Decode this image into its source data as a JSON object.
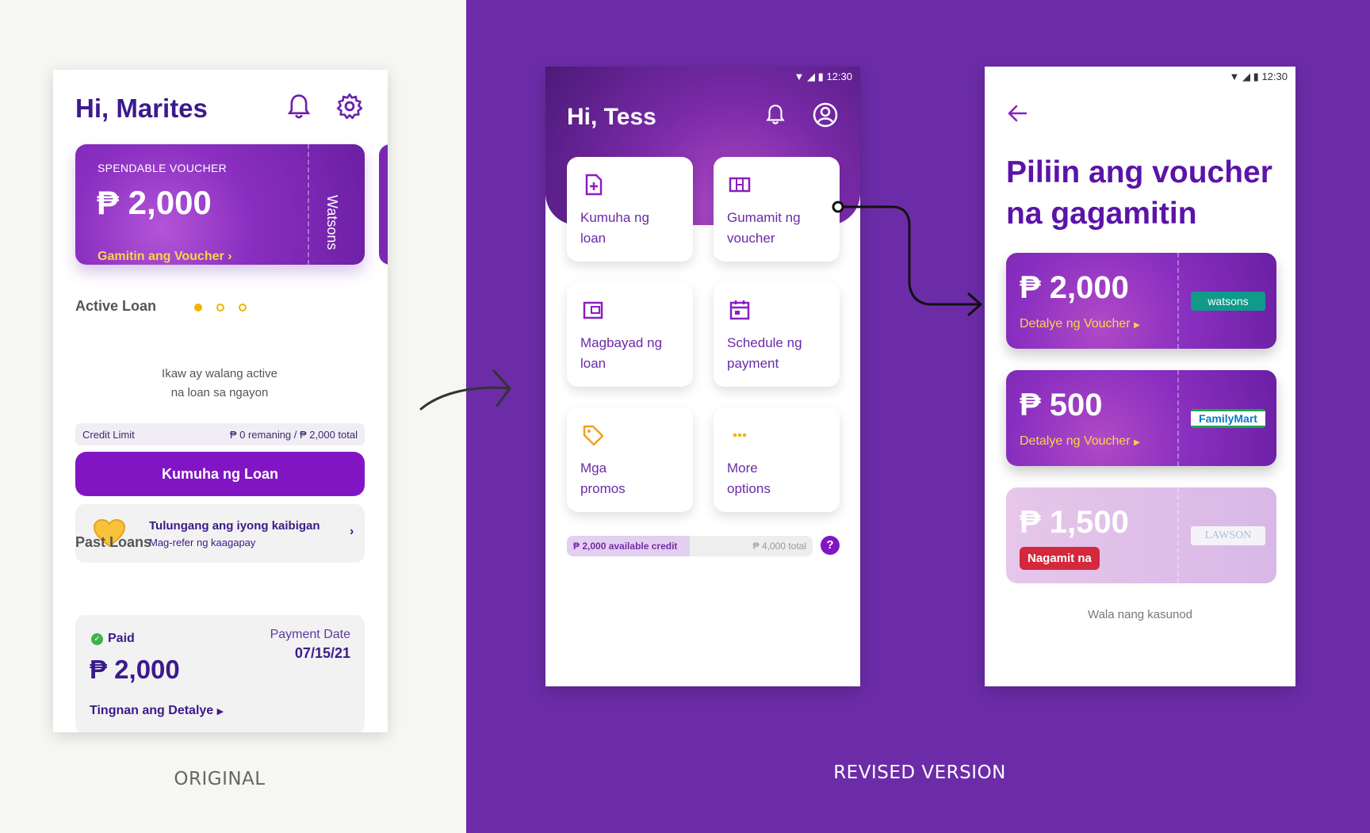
{
  "captions": {
    "original": "ORIGINAL",
    "revised": "REVISED VERSION"
  },
  "original": {
    "greeting": "Hi, Marites",
    "voucher": {
      "label": "SPENDABLE VOUCHER",
      "amount": "₱ 2,000",
      "link": "Gamitin ang Voucher",
      "brand": "Watsons"
    },
    "carousel": {
      "count": 3,
      "active": 1
    },
    "active_loan": {
      "heading": "Active Loan",
      "empty_line1": "Ikaw ay walang active",
      "empty_line2": "na loan sa ngayon"
    },
    "credit": {
      "label": "Credit Limit",
      "value": "₱ 0 remaning / ₱ 2,000 total"
    },
    "loan_button": "Kumuha ng Loan",
    "refer": {
      "title": "Tulungang ang iyong kaibigan",
      "subtitle": "Mag-refer ng kaagapay"
    },
    "past_loans": {
      "heading": "Past Loans",
      "status": "Paid",
      "amount": "₱ 2,000",
      "date_label": "Payment Date",
      "date": "07/15/21",
      "link": "Tingnan ang Detalye"
    }
  },
  "revised_home": {
    "time": "12:30",
    "greeting": "Hi, Tess",
    "tiles": [
      {
        "line1": "Kumuha ng",
        "line2": "loan",
        "icon": "loan-icon"
      },
      {
        "line1": "Gumamit ng",
        "line2": "voucher",
        "icon": "voucher-icon"
      },
      {
        "line1": "Magbayad ng",
        "line2": "loan",
        "icon": "wallet-icon"
      },
      {
        "line1": "Schedule ng",
        "line2": "payment",
        "icon": "calendar-icon"
      },
      {
        "line1": "Mga",
        "line2": "promos",
        "icon": "tag-icon"
      },
      {
        "line1": "More",
        "line2": "options",
        "icon": "more-icon"
      }
    ],
    "credit": {
      "available": "₱ 2,000 available credit",
      "total": "₱ 4,000 total",
      "fraction": 0.5
    },
    "help": "?"
  },
  "revised_vouchers": {
    "time": "12:30",
    "title": "Piliin ang voucher na gagamitin",
    "vouchers": [
      {
        "amount": "₱ 2,000",
        "link": "Detalye ng Voucher",
        "brand": "watsons"
      },
      {
        "amount": "₱ 500",
        "link": "Detalye ng Voucher",
        "brand": "FamilyMart"
      },
      {
        "amount": "₱ 1,500",
        "status": "Nagamit na",
        "brand": "LAWSON"
      }
    ],
    "end_note": "Wala nang kasunod"
  },
  "colors": {
    "brand_purple": "#6c2ca8",
    "accent_yellow": "#f8d54a",
    "primary_button": "#8115c4",
    "used_tag": "#d4283c"
  }
}
